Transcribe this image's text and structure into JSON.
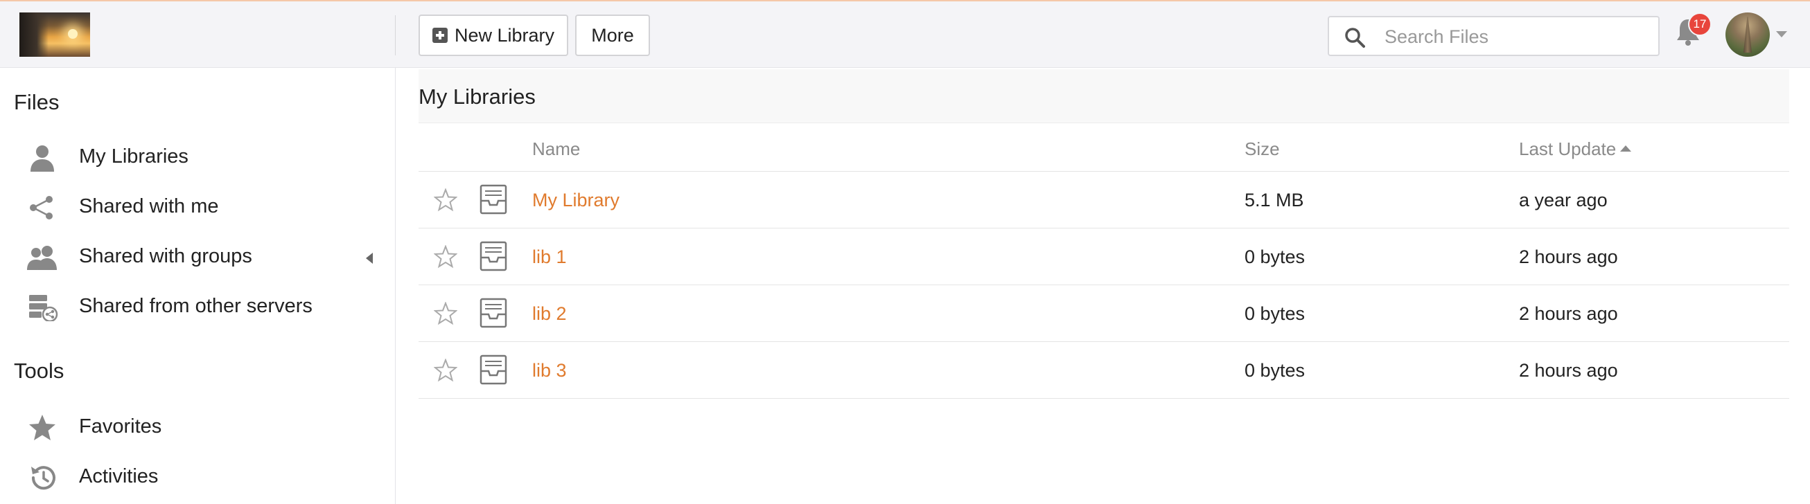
{
  "header": {
    "new_library_label": "New Library",
    "more_label": "More",
    "search_placeholder": "Search Files",
    "notification_count": "17"
  },
  "sidebar": {
    "files_title": "Files",
    "files_items": [
      {
        "label": "My Libraries",
        "icon": "person-icon"
      },
      {
        "label": "Shared with me",
        "icon": "share-icon"
      },
      {
        "label": "Shared with groups",
        "icon": "group-icon"
      },
      {
        "label": "Shared from other servers",
        "icon": "server-share-icon"
      }
    ],
    "tools_title": "Tools",
    "tools_items": [
      {
        "label": "Favorites",
        "icon": "star-icon"
      },
      {
        "label": "Activities",
        "icon": "history-icon"
      }
    ]
  },
  "main": {
    "title": "My Libraries",
    "columns": {
      "name": "Name",
      "size": "Size",
      "last_update": "Last Update"
    },
    "rows": [
      {
        "name": "My Library",
        "size": "5.1 MB",
        "last_update": "a year ago"
      },
      {
        "name": "lib 1",
        "size": "0 bytes",
        "last_update": "2 hours ago"
      },
      {
        "name": "lib 2",
        "size": "0 bytes",
        "last_update": "2 hours ago"
      },
      {
        "name": "lib 3",
        "size": "0 bytes",
        "last_update": "2 hours ago"
      }
    ]
  },
  "colors": {
    "accent": "#e07b2e",
    "badge": "#e8453c",
    "header_bg": "#f4f4f7",
    "icon_gray": "#888888"
  }
}
